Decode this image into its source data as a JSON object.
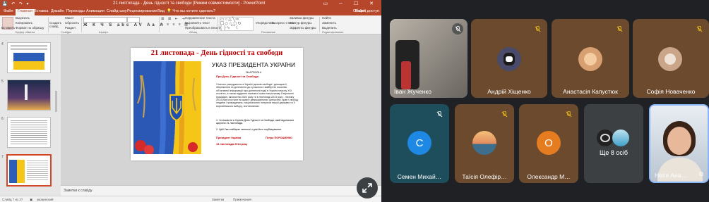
{
  "ppt": {
    "title": "21 листопада - День гідності та свободи [Режим совместимости] - PowerPoint",
    "sign_in": "Войти",
    "share": "Общий доступ",
    "tabs": [
      "Файл",
      "Главная",
      "Вставка",
      "Дизайн",
      "Переходы",
      "Анимация",
      "Слайд-шоу",
      "Рецензирование",
      "Вид",
      "Что вы хотите сделать?"
    ],
    "ribbon": {
      "paste": "Вставить",
      "cut": "Вырезать",
      "copy": "Копировать",
      "format_painter": "Формат по образцу",
      "clipboard_group": "Буфер обмена",
      "new_slide": "Создать слайд",
      "layout": "Макет",
      "reset": "Сбросить",
      "section": "Раздел",
      "slides_group": "Слайды",
      "font_group": "Шрифт",
      "paragraph_group": "Абзац",
      "text_direction": "Направление текста",
      "align_text": "Выровнять текст",
      "smartart": "Преобразовать в SmartArt",
      "arrange": "Упорядочить",
      "quick_styles": "Экспресс-стили",
      "drawing_group": "Рисование",
      "shape_fill": "Заливка фигуры",
      "shape_outline": "Контур фигуры",
      "shape_effects": "Эффекты фигуры",
      "find": "Найти",
      "replace": "Заменить",
      "select": "Выделить",
      "editing_group": "Редактирование"
    },
    "slide_numbers": [
      "4",
      "5",
      "6",
      "7"
    ],
    "slide": {
      "title": "21 листопада - День гідності та свободи",
      "ukaz": "УКАЗ ПРЕЗИДЕНТА УКРАЇНИ",
      "number": "№ 872/2014",
      "about": "Про День Гідності та Свободи",
      "body": "З метою утвердження в Україні ідеалів свободи і демократії, збереження та донесення до сучасного і майбутніх поколінь об'єктивної інформації про доленосні події в Україні початку XXI століття, а також віддання належної шани патріотизму й мужності громадян, які восени 2004 року та в листопаді 2013 року - лютому 2014 року постали на захист демократичних цінностей, прав і свобод людини і громадянина, національних інтересів нашої держави та її європейського вибору, постановляю:",
      "point1": "1. Установити в Україні День Гідності та Свободи, який відзначати щорічно 21 листопада.",
      "point2": "2. Цей Указ набирає чинності з дня його опублікування.",
      "president_label": "Президент України",
      "president_name": "Петро ПОРОШЕНКО",
      "date": "13 листопада 2014 року"
    },
    "notes_placeholder": "Заметки к слайду",
    "status": {
      "slide_of": "Слайд 7 из 27",
      "language": "украинский",
      "notes": "Заметки",
      "comments": "Примечания"
    }
  },
  "meet": {
    "participants": [
      {
        "name": "Іван Жученко",
        "muted": false
      },
      {
        "name": "Андрій Хіщенко",
        "muted": true
      },
      {
        "name": "Анастасія Капустюк",
        "muted": true
      },
      {
        "name": "Софія Новаченко",
        "muted": true
      },
      {
        "name": "Семен Михай…",
        "letter": "С",
        "muted": true
      },
      {
        "name": "Таїсія Олефір…",
        "muted": true
      },
      {
        "name": "Олександр М…",
        "letter": "О",
        "muted": true
      },
      {
        "name": "Ще 8 осіб"
      },
      {
        "name": "Неля Ана…"
      }
    ],
    "colors": {
      "tile_dark": "#3c4043",
      "tile_brown": "#6b4a2e",
      "tile_teal": "#1e4d5c",
      "letter_blue": "#1e88e5",
      "letter_orange": "#e67c20"
    }
  }
}
